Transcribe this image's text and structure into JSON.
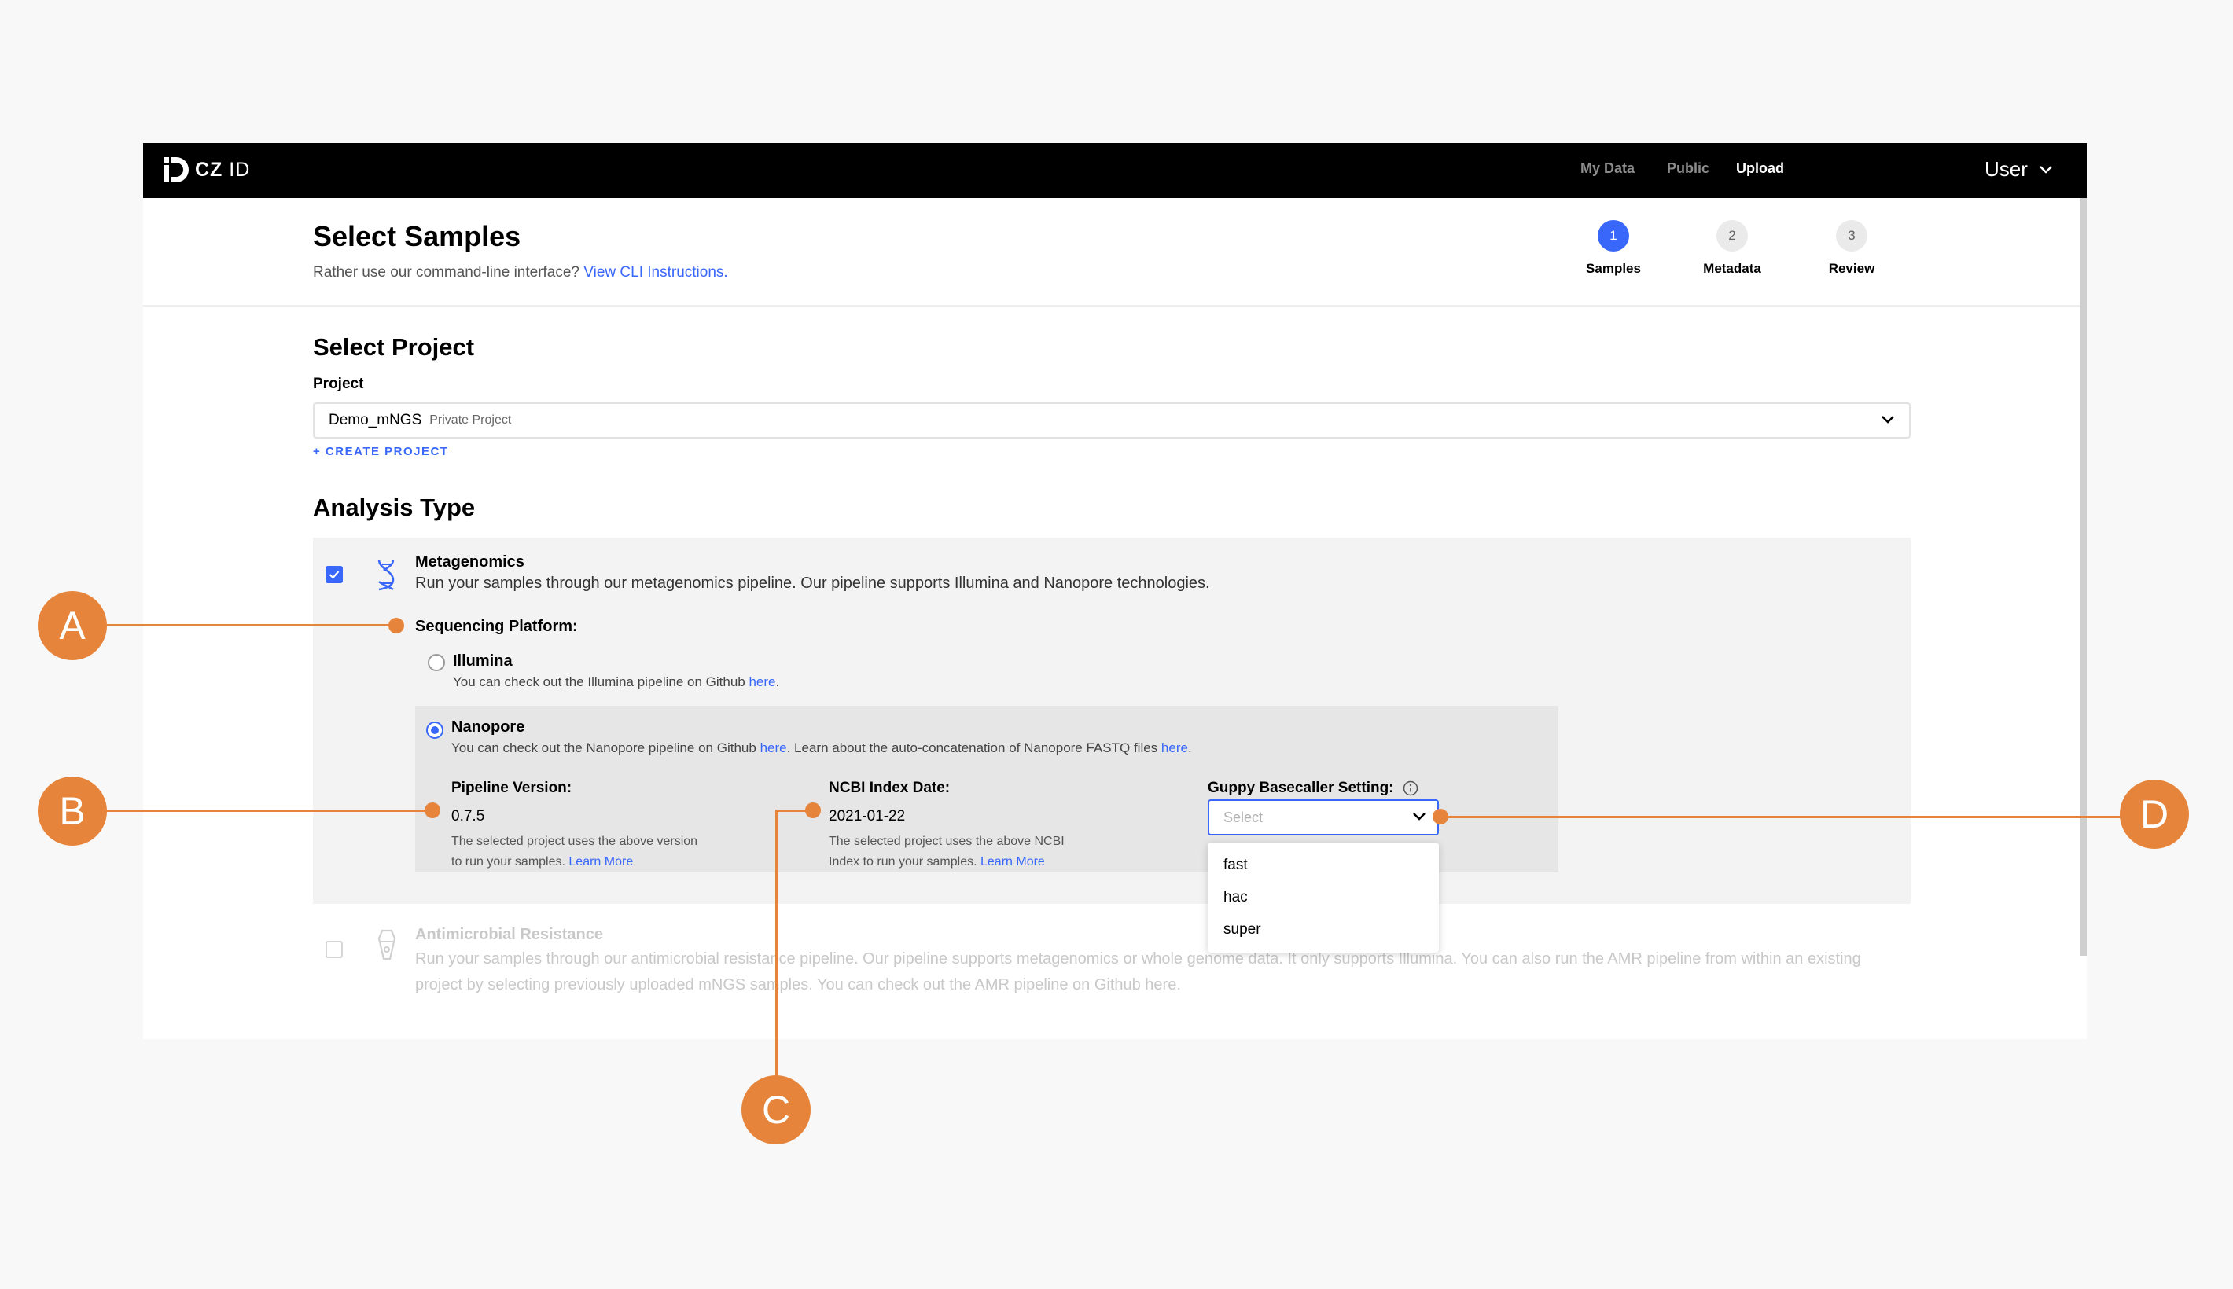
{
  "navbar": {
    "logo_text": "CZ",
    "logo_suffix": "ID",
    "links": [
      "My Data",
      "Public",
      "Upload"
    ],
    "active_link": "Upload",
    "user": "User"
  },
  "header": {
    "title": "Select Samples",
    "cli_prefix": "Rather use our command-line interface?",
    "cli_link": "View CLI Instructions."
  },
  "steps": [
    {
      "number": "1",
      "label": "Samples",
      "active": true
    },
    {
      "number": "2",
      "label": "Metadata",
      "active": false
    },
    {
      "number": "3",
      "label": "Review",
      "active": false
    }
  ],
  "project_section": {
    "title": "Select Project",
    "field_label": "Project",
    "selected_project": "Demo_mNGS",
    "project_tag": "Private Project",
    "create_link": "+ CREATE PROJECT"
  },
  "analysis": {
    "title": "Analysis Type",
    "metagenomics": {
      "title": "Metagenomics",
      "description": "Run your samples through our metagenomics pipeline. Our pipeline supports Illumina and Nanopore technologies.",
      "checked": true
    },
    "sequencing_platform_label": "Sequencing Platform:",
    "illumina": {
      "title": "Illumina",
      "desc_prefix": "You can check out the Illumina pipeline on Github",
      "desc_link": "here",
      "desc_suffix": "."
    },
    "nanopore": {
      "title": "Nanopore",
      "desc_prefix": "You can check out the Nanopore pipeline on Github",
      "desc_link1": "here",
      "desc_mid": ". Learn about the auto-concatenation of Nanopore FASTQ files",
      "desc_link2": "here",
      "desc_suffix": "."
    },
    "pipeline_version": {
      "label": "Pipeline Version:",
      "value": "0.7.5",
      "desc_line1": "The selected project uses the above version",
      "desc_line2": "to run your samples.",
      "link": "Learn More"
    },
    "ncbi_index": {
      "label": "NCBI Index Date:",
      "value": "2021-01-22",
      "desc_line1": "The selected project uses the above NCBI",
      "desc_line2": "Index to run your samples.",
      "link": "Learn More"
    },
    "guppy": {
      "label": "Guppy Basecaller Setting:",
      "placeholder": "Select",
      "options": [
        "fast",
        "hac",
        "super"
      ]
    },
    "amr": {
      "title": "Antimicrobial Resistance",
      "description": "Run your samples through our antimicrobial resistance pipeline. Our pipeline supports metagenomics or whole genome data. It only supports Illumina. You can also run the AMR pipeline from within an existing project by selecting previously uploaded mNGS samples. You can check out the AMR pipeline on Github here.",
      "checked": false
    }
  },
  "annotations": [
    "A",
    "B",
    "C",
    "D"
  ],
  "colors": {
    "accent": "#3867fa",
    "annotation": "#e5843a",
    "navbar": "#000000"
  }
}
